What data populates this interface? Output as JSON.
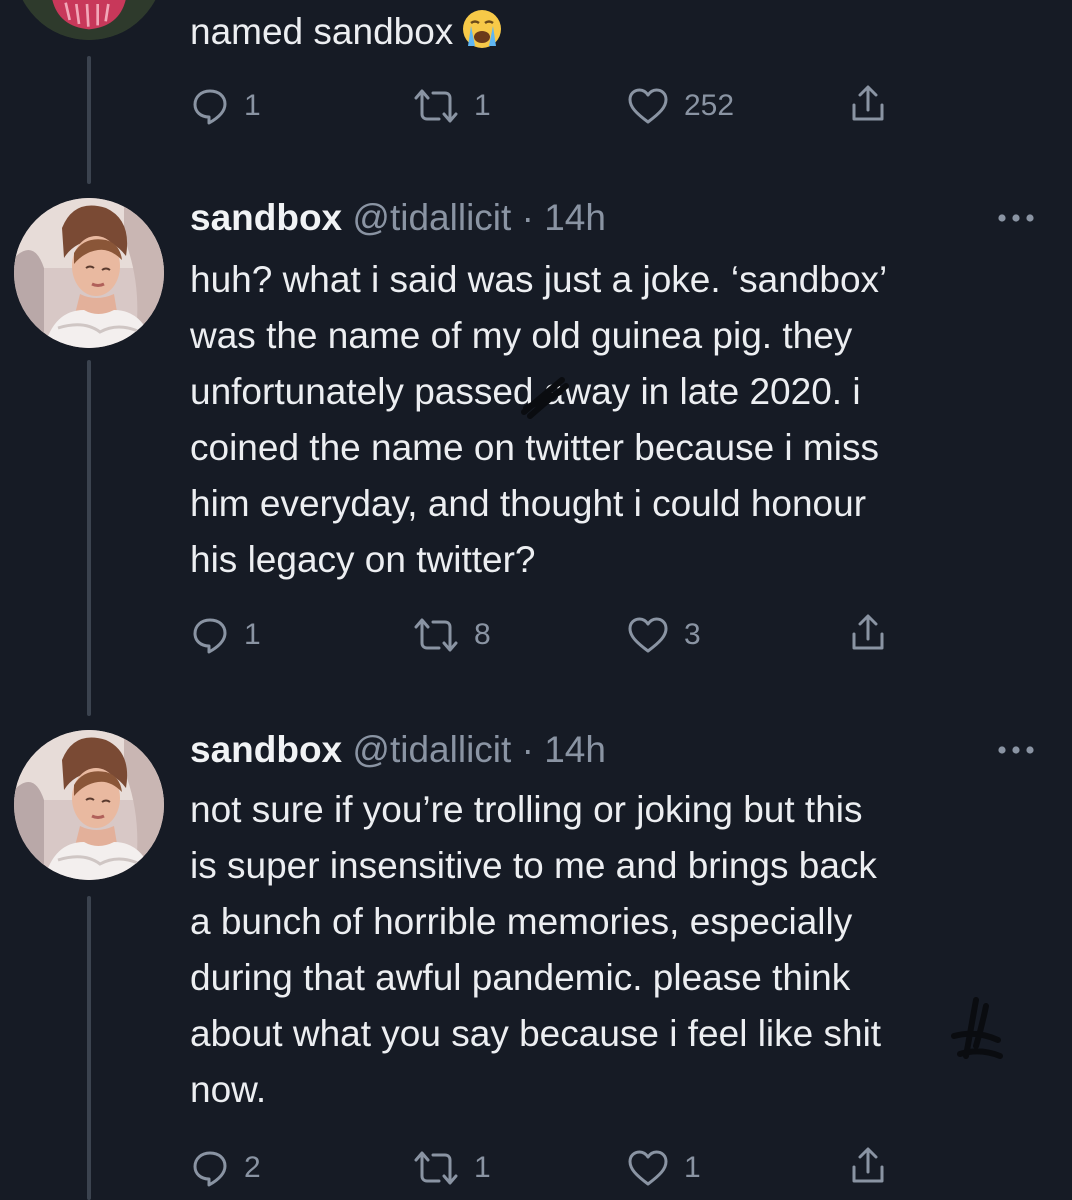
{
  "colors": {
    "background": "#161b25",
    "text": "#eceef1",
    "muted": "#8a94a3",
    "thread_line": "#3b434f"
  },
  "top_tweet": {
    "partial_text": "named sandbox",
    "emoji": "loudly-crying-face",
    "replies": "1",
    "retweets": "1",
    "likes": "252"
  },
  "tweets": [
    {
      "name": "sandbox",
      "handle": "@tidallicit",
      "time": "· 14h",
      "lines": [
        "huh? what i said was just a joke. ‘sandbox’",
        "was the name of my old guinea pig. they",
        "unfortunately passed away in late 2020. i",
        "coined the name on twitter because i miss",
        "him everyday, and thought i could honour",
        "his legacy on twitter?"
      ],
      "replies": "1",
      "retweets": "8",
      "likes": "3"
    },
    {
      "name": "sandbox",
      "handle": "@tidallicit",
      "time": "· 14h",
      "lines": [
        "not sure if you’re trolling or joking but this",
        "is super insensitive to me and brings back",
        "a bunch of horrible memories, especially",
        "during that awful pandemic. please think",
        "about what you say because i feel like shit",
        "now."
      ],
      "replies": "2",
      "retweets": "1",
      "likes": "1"
    }
  ],
  "icons": {
    "reply": "reply-icon",
    "retweet": "retweet-icon",
    "like": "heart-icon",
    "share": "share-icon",
    "more": "more-icon"
  }
}
